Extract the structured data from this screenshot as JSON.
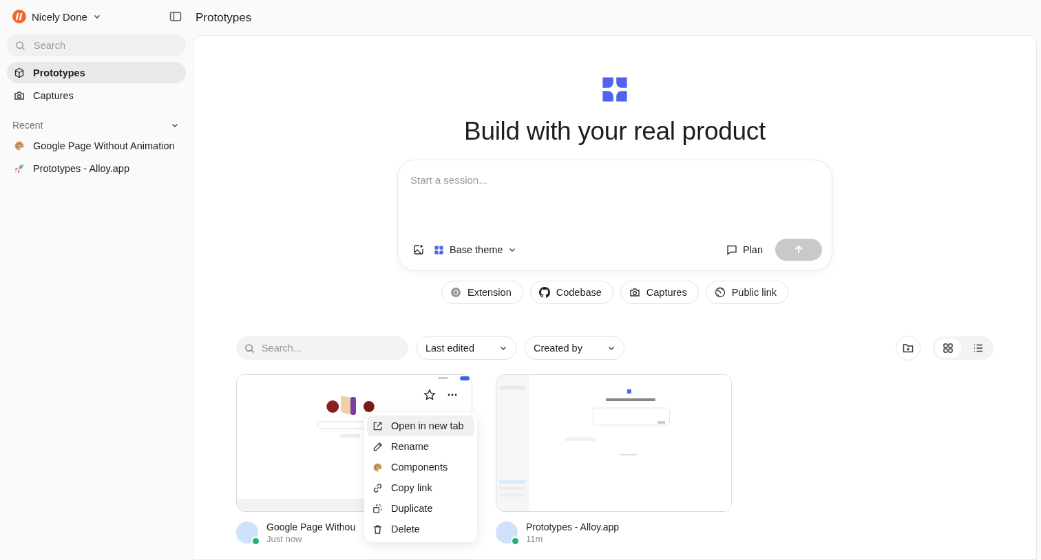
{
  "workspace": {
    "name": "Nicely Done"
  },
  "sidebar": {
    "search": {
      "placeholder": "Search"
    },
    "nav": [
      {
        "label": "Prototypes",
        "kind": "cube",
        "selected": true
      },
      {
        "label": "Captures",
        "kind": "camera",
        "selected": false
      }
    ],
    "recent": {
      "title": "Recent",
      "items": [
        {
          "label": "Google Page Without Animation",
          "kind": "palette"
        },
        {
          "label": "Prototypes - Alloy.app",
          "kind": "rocket"
        }
      ]
    }
  },
  "page": {
    "title": "Prototypes"
  },
  "hero": {
    "title": "Build with your real product",
    "composer": {
      "placeholder": "Start a session...",
      "theme": "Base theme",
      "plan": "Plan",
      "send_enabled": false
    },
    "sources": [
      {
        "label": "Extension",
        "kind": "chrome"
      },
      {
        "label": "Codebase",
        "kind": "github"
      },
      {
        "label": "Captures",
        "kind": "camera"
      },
      {
        "label": "Public link",
        "kind": "globe"
      }
    ]
  },
  "toolbar": {
    "search": {
      "placeholder": "Search..."
    },
    "filters": [
      "Last edited",
      "Created by"
    ],
    "views": [
      {
        "kind": "grid",
        "selected": true
      },
      {
        "kind": "list",
        "selected": false
      }
    ]
  },
  "projects": [
    {
      "title": "Google Page Withou",
      "time": "Just now",
      "kind": "google",
      "context_menu": {
        "items": [
          {
            "label": "Open in new tab",
            "kind": "open",
            "selected": true
          },
          {
            "label": "Rename",
            "kind": "pencil",
            "selected": false
          },
          {
            "label": "Components",
            "kind": "palette",
            "selected": false
          },
          {
            "label": "Copy link",
            "kind": "link",
            "selected": false
          },
          {
            "label": "Duplicate",
            "kind": "duplicate",
            "selected": false
          },
          {
            "label": "Delete",
            "kind": "trash",
            "selected": false
          }
        ]
      }
    },
    {
      "title": "Prototypes - Alloy.app",
      "time": "11m",
      "kind": "app"
    }
  ]
}
